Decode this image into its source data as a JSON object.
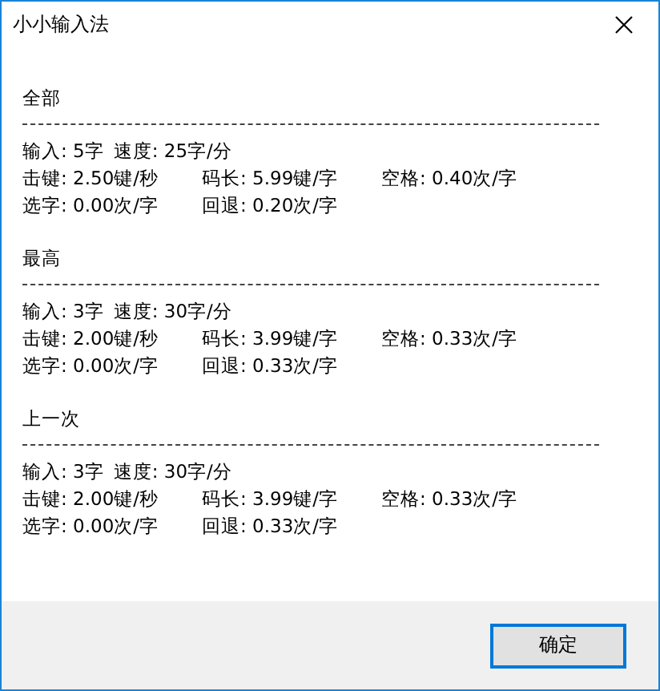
{
  "window": {
    "title": "小小输入法"
  },
  "sections": [
    {
      "heading": "全部",
      "summary": [
        "输入: 5字",
        "速度: 25字/分"
      ],
      "stats": [
        [
          "击键: 2.50键/秒",
          "码长: 5.99键/字",
          "空格: 0.40次/字"
        ],
        [
          "选字: 0.00次/字",
          "回退: 0.20次/字"
        ]
      ]
    },
    {
      "heading": "最高",
      "summary": [
        "输入: 3字",
        "速度: 30字/分"
      ],
      "stats": [
        [
          "击键: 2.00键/秒",
          "码长: 3.99键/字",
          "空格: 0.33次/字"
        ],
        [
          "选字: 0.00次/字",
          "回退: 0.33次/字"
        ]
      ]
    },
    {
      "heading": "上一次",
      "summary": [
        "输入: 3字",
        "速度: 30字/分"
      ],
      "stats": [
        [
          "击键: 2.00键/秒",
          "码长: 3.99键/字",
          "空格: 0.33次/字"
        ],
        [
          "选字: 0.00次/字",
          "回退: 0.33次/字"
        ]
      ]
    }
  ],
  "buttons": [
    {
      "label": "确定",
      "default": true
    }
  ]
}
